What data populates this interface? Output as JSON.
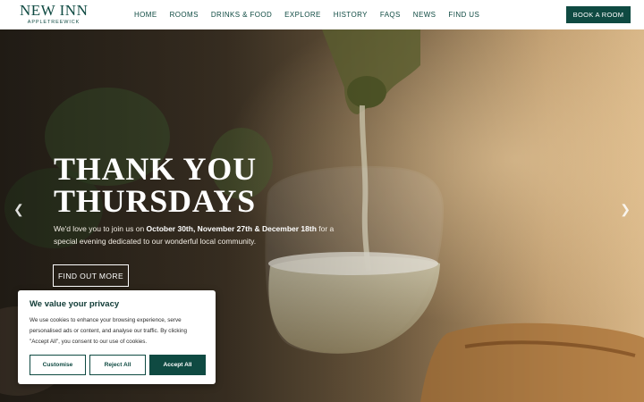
{
  "logo": {
    "main": "NEW INN",
    "sub": "APPLETREEWICK"
  },
  "nav": {
    "items": [
      "HOME",
      "ROOMS",
      "DRINKS & FOOD",
      "EXPLORE",
      "HISTORY",
      "FAQS",
      "NEWS",
      "FIND US"
    ],
    "book_label": "BOOK A ROOM"
  },
  "hero": {
    "title_line1": "THANK YOU",
    "title_line2": "THURSDAYS",
    "text_pre": "We'd love you to join us on ",
    "text_dates": "October 30th, November 27th & December 18th",
    "text_post": " for a special evening dedicated to our wonderful local community.",
    "button_label": "FIND OUT MORE",
    "prev_icon": "chevron-left-icon",
    "next_icon": "chevron-right-icon"
  },
  "cookie": {
    "title": "We value your privacy",
    "text": "We use cookies to enhance your browsing experience, serve personalised ads or content, and analyse our traffic. By clicking \"Accept All\", you consent to our use of cookies.",
    "customise_label": "Customise",
    "reject_label": "Reject All",
    "accept_label": "Accept All"
  },
  "colors": {
    "brand": "#0f4a42",
    "white": "#ffffff"
  }
}
